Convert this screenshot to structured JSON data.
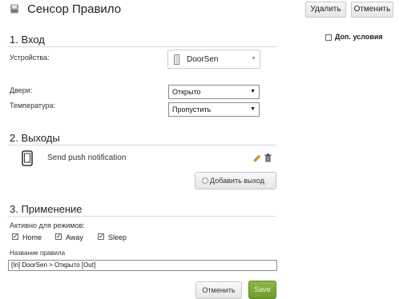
{
  "header": {
    "title": "Сенсор Правило",
    "delete_label": "Удалить",
    "cancel_label": "Отменить"
  },
  "extra_conditions": {
    "label": "Доп. условия",
    "checked": false
  },
  "section_input": {
    "title": "1. Вход",
    "devices_label": "Устройства:",
    "device_name": "DoorSen",
    "doors_label": "Двери:",
    "doors_value": "Открыто",
    "temperature_label": "Температура:",
    "temperature_value": "Пропустить"
  },
  "section_outputs": {
    "title": "2. Выходы",
    "outputs": [
      {
        "label": "Send push notification"
      }
    ],
    "add_output_label": "Добавить выход"
  },
  "section_apply": {
    "title": "3. Применение",
    "modes_label": "Активно для режимов:",
    "modes": [
      {
        "label": "Home",
        "checked": true
      },
      {
        "label": "Away",
        "checked": true
      },
      {
        "label": "Sleep",
        "checked": true
      }
    ],
    "rule_name_label": "Название правила",
    "rule_name_value": "[In] DoorSen > Открыто  [Out]"
  },
  "footer": {
    "cancel_label": "Отменить",
    "save_label": "Save"
  },
  "colors": {
    "save_green": "#7ea63a",
    "edit_pencil": "#d9a21b"
  },
  "icons": {
    "header": "save-icon",
    "device": "door-icon",
    "output": "phone-icon",
    "edit": "pencil-icon",
    "delete": "trash-icon",
    "add": "plus-icon"
  }
}
